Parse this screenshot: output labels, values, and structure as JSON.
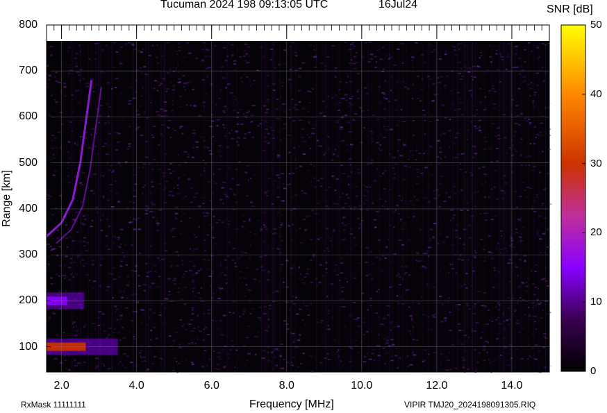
{
  "header": {
    "station": "Tucuman 2024 198 09:13:05 UTC",
    "date": "16Jul24"
  },
  "footer": {
    "left": "RxMask 11111111",
    "right": "VIPIR  TMJ20_2024198091305.RIQ"
  },
  "chart_data": {
    "type": "heatmap",
    "title": "Tucuman 2024 198 09:13:05 UTC",
    "xlabel": "Frequency [MHz]",
    "ylabel": "Range [km]",
    "xlim": [
      1.6,
      15.0
    ],
    "ylim": [
      45,
      800
    ],
    "x_ticks": [
      2.0,
      4.0,
      6.0,
      8.0,
      10.0,
      12.0,
      14.0
    ],
    "x_tick_labels": [
      "2.0",
      "4.0",
      "6.0",
      "8.0",
      "10.0",
      "12.0",
      "14.0"
    ],
    "y_ticks": [
      100,
      200,
      300,
      400,
      500,
      600,
      700,
      800
    ],
    "y_tick_labels": [
      "100",
      "200",
      "300",
      "400",
      "500",
      "600",
      "700",
      "800"
    ],
    "grid": true,
    "colorbar": {
      "label": "SNR [dB]",
      "range": [
        0,
        50
      ],
      "ticks": [
        0,
        10,
        20,
        30,
        40,
        50
      ],
      "tick_labels": [
        "0",
        "10",
        "20",
        "30",
        "40",
        "50"
      ],
      "colors": [
        "#000000",
        "#3a0050",
        "#8a00ff",
        "#c0309a",
        "#cc3300",
        "#ff8800",
        "#ffff00"
      ]
    },
    "echo_features": [
      {
        "name": "E-layer echo",
        "freq_range": [
          1.6,
          3.5
        ],
        "range_km": 100,
        "snr_db": 30
      },
      {
        "name": "E-layer second hop",
        "freq_range": [
          1.6,
          2.6
        ],
        "range_km": 200,
        "snr_db": 14
      },
      {
        "name": "F-layer trace",
        "points": [
          [
            1.6,
            340
          ],
          [
            2.0,
            370
          ],
          [
            2.3,
            420
          ],
          [
            2.5,
            500
          ],
          [
            2.7,
            620
          ],
          [
            2.8,
            680
          ]
        ],
        "snr_db": 18
      }
    ]
  }
}
